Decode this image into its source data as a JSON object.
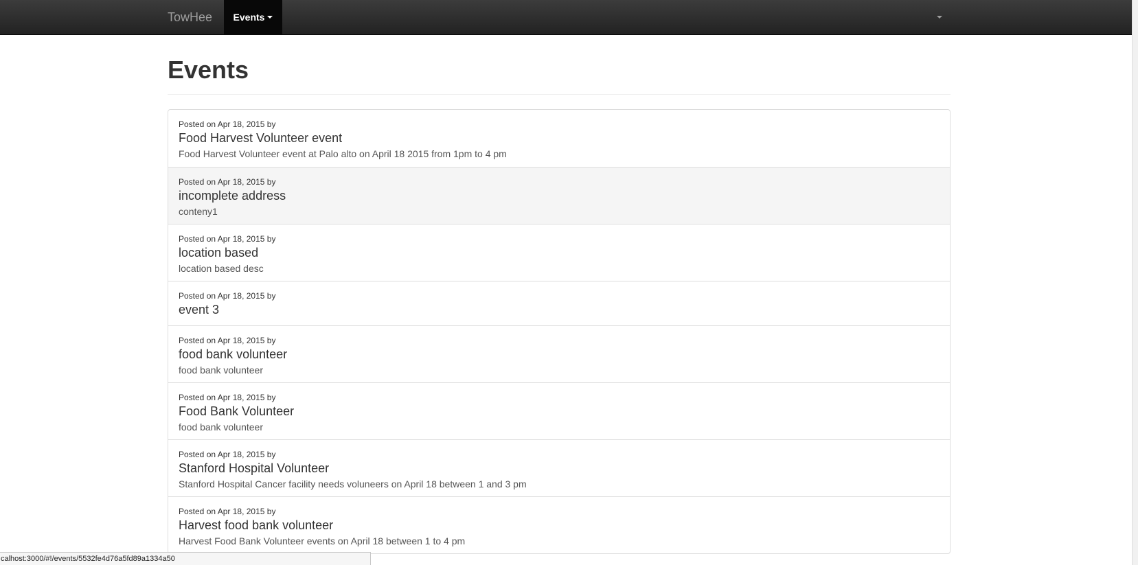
{
  "navbar": {
    "brand": "TowHee",
    "events_label": "Events"
  },
  "page": {
    "title": "Events"
  },
  "events": [
    {
      "meta": "Posted on Apr 18, 2015 by",
      "title": "Food Harvest Volunteer event",
      "description": "Food Harvest Volunteer event at Palo alto on April 18 2015 from 1pm to 4 pm"
    },
    {
      "meta": "Posted on Apr 18, 2015 by",
      "title": "incomplete address",
      "description": "conteny1"
    },
    {
      "meta": "Posted on Apr 18, 2015 by",
      "title": "location based",
      "description": "location based desc"
    },
    {
      "meta": "Posted on Apr 18, 2015 by",
      "title": "event 3",
      "description": ""
    },
    {
      "meta": "Posted on Apr 18, 2015 by",
      "title": "food bank volunteer",
      "description": "food bank volunteer"
    },
    {
      "meta": "Posted on Apr 18, 2015 by",
      "title": "Food Bank Volunteer",
      "description": "food bank volunteer"
    },
    {
      "meta": "Posted on Apr 18, 2015 by",
      "title": "Stanford Hospital Volunteer",
      "description": "Stanford Hospital Cancer facility needs voluneers on April 18 between 1 and 3 pm"
    },
    {
      "meta": "Posted on Apr 18, 2015 by",
      "title": "Harvest food bank volunteer",
      "description": "Harvest Food Bank Volunteer events on April 18 between 1 to 4 pm"
    }
  ],
  "statusbar": {
    "url": "calhost:3000/#!/events/5532fe4d76a5fd89a1334a50"
  },
  "colors": {
    "navbar_bg": "#222222",
    "active_nav_bg": "#080808",
    "hover_row_bg": "#f5f5f5",
    "border": "#dddddd"
  },
  "icons": {
    "events_caret": "caret-down-icon",
    "user_menu_caret": "caret-down-icon"
  }
}
